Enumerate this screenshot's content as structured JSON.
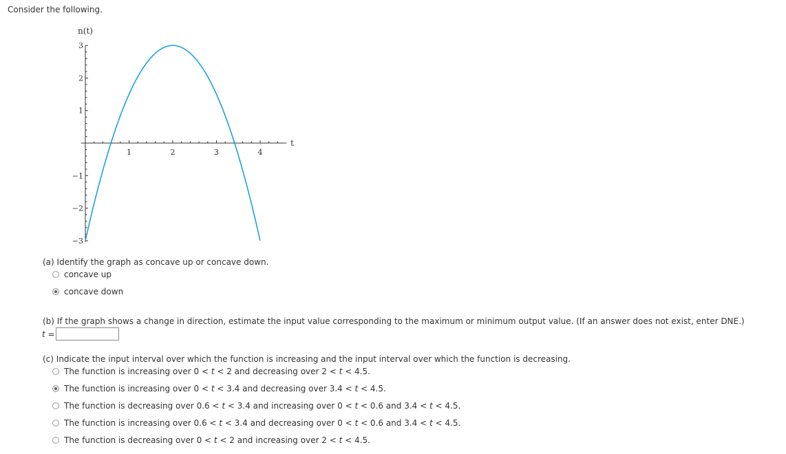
{
  "intro": "Consider the following.",
  "chart_data": {
    "type": "line",
    "function": "n(t) = -1.5(t - 2)^2 + 3",
    "x": [
      0,
      0.25,
      0.5,
      0.586,
      0.75,
      1,
      1.25,
      1.5,
      1.75,
      2,
      2.25,
      2.5,
      2.75,
      3,
      3.25,
      3.414,
      3.5,
      3.75,
      4
    ],
    "y": [
      -3,
      -1.59,
      -0.375,
      0,
      0.656,
      1.5,
      2.156,
      2.625,
      2.906,
      3,
      2.906,
      2.625,
      2.156,
      1.5,
      0.656,
      0,
      -0.375,
      -1.59,
      -3
    ],
    "series": [
      {
        "name": "n(t)",
        "color": "#1ba1e2"
      }
    ],
    "xlabel": "t",
    "ylabel": "n(t)",
    "xticks": [
      "1",
      "2",
      "3",
      "4"
    ],
    "yticks": [
      "3",
      "2",
      "1",
      "−1",
      "−2",
      "−3"
    ],
    "xtick_values": [
      1,
      2,
      3,
      4
    ],
    "ytick_values": [
      3,
      2,
      1,
      -1,
      -2,
      -3
    ],
    "xlim": [
      0,
      4.6
    ],
    "ylim": [
      -3,
      3
    ],
    "minor_tick_step": 0.2,
    "grid": false,
    "legend": "none"
  },
  "part_a": {
    "question": "(a) Identify the graph as concave up or concave down.",
    "options": [
      {
        "label": "concave up",
        "checked": false
      },
      {
        "label": "concave down",
        "checked": true
      }
    ]
  },
  "part_b": {
    "question": "(b) If the graph shows a change in direction, estimate the input value corresponding to the maximum or minimum output value. (If an answer does not exist, enter DNE.)",
    "input_label": "t =",
    "input_value": ""
  },
  "part_c": {
    "question": "(c) Indicate the input interval over which the function is increasing and the input interval over which the function is decreasing.",
    "options": [
      {
        "label": "The function is increasing over 0 < t < 2 and decreasing over 2 < t < 4.5.",
        "checked": false
      },
      {
        "label": "The function is increasing over 0 < t < 3.4 and decreasing over 3.4 < t < 4.5.",
        "checked": true
      },
      {
        "label": "The function is decreasing over 0.6 < t < 3.4 and increasing over 0 < t < 0.6 and 3.4 < t < 4.5.",
        "checked": false
      },
      {
        "label": "The function is increasing over 0.6 < t < 3.4 and decreasing over 0 < t < 0.6 and 3.4 < t < 4.5.",
        "checked": false
      },
      {
        "label": "The function is decreasing over 0 < t < 2 and increasing over 2 < t < 4.5.",
        "checked": false
      }
    ]
  }
}
